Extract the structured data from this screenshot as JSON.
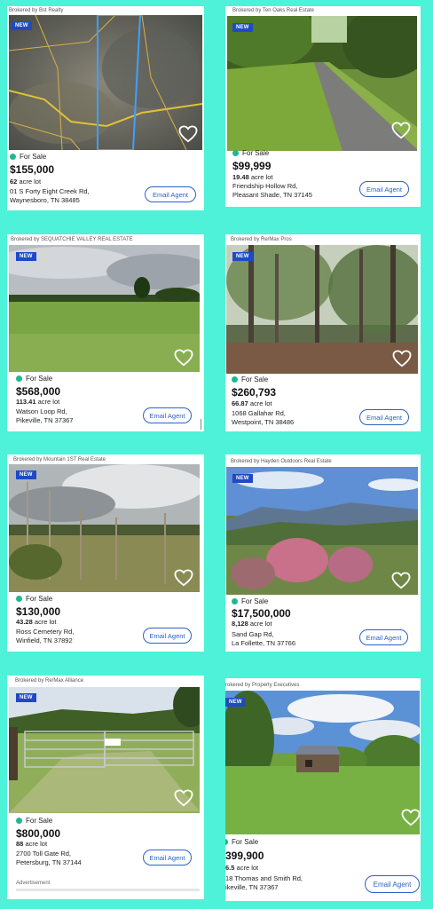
{
  "listings": [
    {
      "broker": "Brokered by Bst Realty",
      "badge": "NEW",
      "status": "For Sale",
      "price": "$155,000",
      "lot_size": "62",
      "lot_unit": "acre lot",
      "address_line1": "01 S Forty Eight Creek Rd,",
      "address_line2": "Waynesboro, TN 38485",
      "button": "Email Agent"
    },
    {
      "broker": "Brokered by Ten Oaks Real Estate",
      "badge": "NEW",
      "status": "For Sale",
      "price": "$99,999",
      "lot_size": "19.48",
      "lot_unit": "acre lot",
      "address_line1": "Friendship Hollow Rd,",
      "address_line2": "Pleasant Shade, TN 37145",
      "button": "Email Agent"
    },
    {
      "broker": "Brokered by SEQUATCHIE VALLEY REAL ESTATE",
      "badge": "NEW",
      "status": "For Sale",
      "price": "$568,000",
      "lot_size": "113.41",
      "lot_unit": "acre lot",
      "address_line1": "Watson Loop Rd,",
      "address_line2": "Pikeville, TN 37367",
      "button": "Email Agent"
    },
    {
      "broker": "Brokered by Re/Max Pros",
      "badge": "NEW",
      "status": "For Sale",
      "price": "$260,793",
      "lot_size": "66.87",
      "lot_unit": "acre lot",
      "address_line1": "1068 Gallahar Rd,",
      "address_line2": "Westpoint, TN 38486",
      "button": "Email Agent"
    },
    {
      "broker": "Brokered by Mountain 1ST Real Estate",
      "badge": "NEW",
      "status": "For Sale",
      "price": "$130,000",
      "lot_size": "43.28",
      "lot_unit": "acre lot",
      "address_line1": "Ross Cemetery Rd,",
      "address_line2": "Winfield, TN 37892",
      "button": "Email Agent"
    },
    {
      "broker": "Brokered by Hayden Outdoors Real Estate",
      "badge": "NEW",
      "status": "For Sale",
      "price": "$17,500,000",
      "lot_size": "8,128",
      "lot_unit": "acre lot",
      "address_line1": "Sand Gap Rd,",
      "address_line2": "La Follette, TN 37766",
      "button": "Email Agent"
    },
    {
      "broker": "Brokered by Re/Max Alliance",
      "badge": "NEW",
      "status": "For Sale",
      "price": "$800,000",
      "lot_size": "88",
      "lot_unit": "acre lot",
      "address_line1": "2700 Toll Gate Rd,",
      "address_line2": "Petersburg, TN 37144",
      "button": "Email Agent"
    },
    {
      "broker": "rokered by Property Executives",
      "badge": "NEW",
      "status": "For Sale",
      "price": "399,900",
      "lot_size": "6.5",
      "lot_unit": "acre lot",
      "address_line1": "18 Thomas and Smith Rd,",
      "address_line2": "ikeville, TN 37367",
      "button": "Email Agent"
    }
  ],
  "advertisement_label": "Advertisement",
  "colors": {
    "background": "#4ef2d8",
    "accent": "#2a62c9",
    "badge": "#1f49c5",
    "status_dot": "#1fb890"
  },
  "icons": {
    "favorite": "heart-icon",
    "status": "status-dot-icon"
  }
}
